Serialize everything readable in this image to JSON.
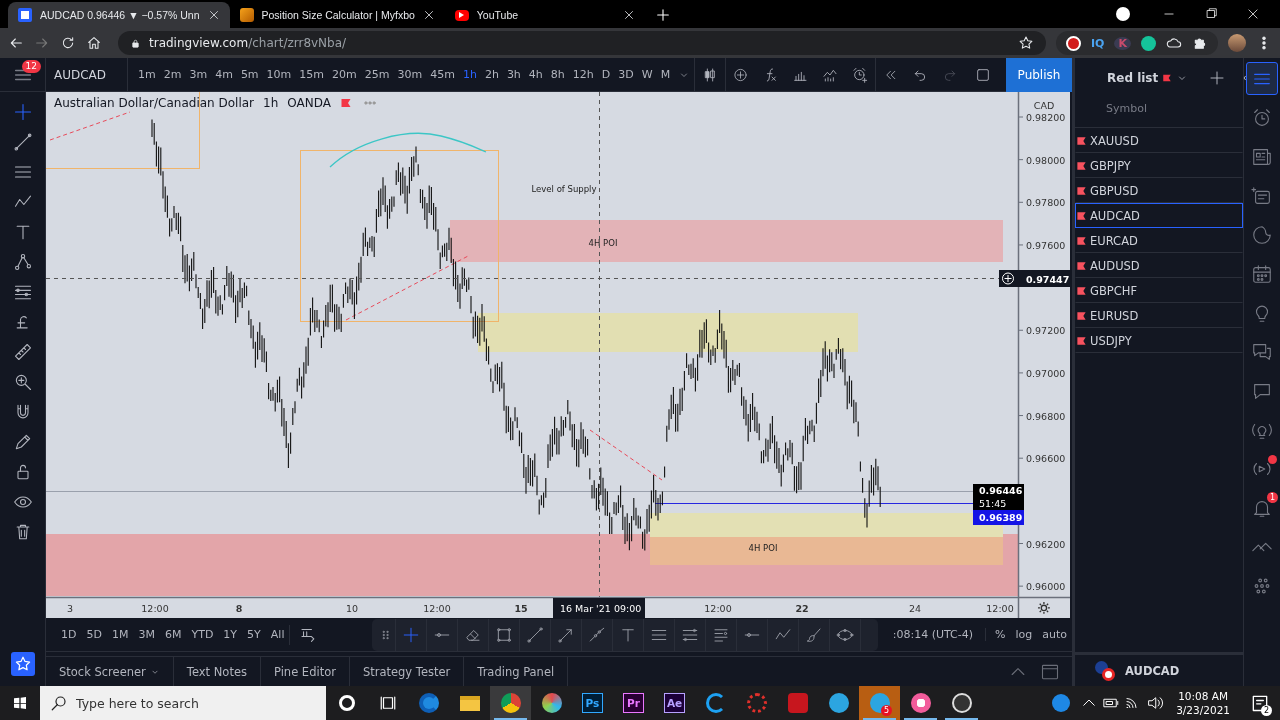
{
  "browser": {
    "tabs": [
      {
        "title": "AUDCAD 0.96446 ▼ −0.57% Unn",
        "kind": "tradingview",
        "selected": true
      },
      {
        "title": "Position Size Calculator | Myfxbo",
        "kind": "fx",
        "selected": false
      },
      {
        "title": "YouTube",
        "kind": "youtube",
        "selected": false
      }
    ],
    "url_host": "tradingview.com",
    "url_path": "/chart/zrr8vNba/",
    "extensions": [
      "IQ",
      "K"
    ]
  },
  "toolbar": {
    "menu_badge": "12",
    "symbol": "AUDCAD",
    "intervals": [
      {
        "label": "1m",
        "selected": false
      },
      {
        "label": "2m",
        "selected": false
      },
      {
        "label": "3m",
        "selected": false
      },
      {
        "label": "4m",
        "selected": false
      },
      {
        "label": "5m",
        "selected": false
      },
      {
        "label": "10m",
        "selected": false
      },
      {
        "label": "15m",
        "selected": false
      },
      {
        "label": "20m",
        "selected": false
      },
      {
        "label": "25m",
        "selected": false
      },
      {
        "label": "30m",
        "selected": false
      },
      {
        "label": "45m",
        "selected": false
      },
      {
        "label": "1h",
        "selected": true
      },
      {
        "label": "2h",
        "selected": false
      },
      {
        "label": "3h",
        "selected": false
      },
      {
        "label": "4h",
        "selected": false
      },
      {
        "label": "8h",
        "selected": false
      },
      {
        "label": "12h",
        "selected": false
      },
      {
        "label": "D",
        "selected": false
      },
      {
        "label": "3D",
        "selected": false
      },
      {
        "label": "W",
        "selected": false
      },
      {
        "label": "M",
        "selected": false
      }
    ],
    "publish": "Publish"
  },
  "chart": {
    "legend": {
      "name": "Australian Dollar/Canadian Dollar",
      "interval": "1h",
      "exchange": "OANDA"
    },
    "currency": "CAD",
    "price_ticks": [
      "0.98200",
      "0.98000",
      "0.97800",
      "0.97600",
      "0.97200",
      "0.97000",
      "0.96800",
      "0.96600",
      "0.96200",
      "0.96000"
    ],
    "time_ticks": [
      {
        "label": "3",
        "major": false
      },
      {
        "label": "12:00",
        "major": false
      },
      {
        "label": "8",
        "major": true
      },
      {
        "label": "10",
        "major": false
      },
      {
        "label": "12:00",
        "major": false
      },
      {
        "label": "15",
        "major": true
      },
      {
        "label": "12:00",
        "major": false
      },
      {
        "label": "22",
        "major": true
      },
      {
        "label": "24",
        "major": false
      },
      {
        "label": "12:00",
        "major": false
      }
    ],
    "annotations": [
      "Level of Supply",
      "4H POI",
      "4H POI"
    ],
    "crosshair_price": "0.97447",
    "crosshair_date": "16 Mar '21",
    "crosshair_time": "09:00",
    "last_price": "0.96446",
    "countdown": "51:45",
    "line_price": "0.96389"
  },
  "range_bar": {
    "ranges": [
      "1D",
      "5D",
      "1M",
      "3M",
      "6M",
      "YTD",
      "1Y",
      "5Y",
      "All"
    ],
    "clock": ":08:14 (UTC-4)",
    "scale_options": [
      "%",
      "log",
      "auto"
    ]
  },
  "bottom_tabs": [
    "Stock Screener",
    "Text Notes",
    "Pine Editor",
    "Strategy Tester",
    "Trading Panel"
  ],
  "watchlist": {
    "title": "Red list",
    "column": "Symbol",
    "items": [
      {
        "symbol": "XAUUSD",
        "selected": false
      },
      {
        "symbol": "GBPJPY",
        "selected": false
      },
      {
        "symbol": "GBPUSD",
        "selected": false
      },
      {
        "symbol": "AUDCAD",
        "selected": true
      },
      {
        "symbol": "EURCAD",
        "selected": false
      },
      {
        "symbol": "AUDUSD",
        "selected": false
      },
      {
        "symbol": "GBPCHF",
        "selected": false
      },
      {
        "symbol": "EURUSD",
        "selected": false
      },
      {
        "symbol": "USDJPY",
        "selected": false
      }
    ],
    "footer_symbol": "AUDCAD"
  },
  "right_bar": {
    "items": [
      {
        "kind": "watchlist",
        "selected": true
      },
      {
        "kind": "alarm",
        "selected": false
      },
      {
        "kind": "news",
        "selected": false
      },
      {
        "kind": "list",
        "selected": false
      },
      {
        "kind": "hotlist",
        "selected": false
      },
      {
        "kind": "calendar",
        "selected": false
      },
      {
        "kind": "ideas",
        "selected": false
      },
      {
        "kind": "chat",
        "selected": false
      },
      {
        "kind": "messages",
        "selected": false
      },
      {
        "kind": "signal",
        "selected": false
      },
      {
        "kind": "stream",
        "selected": false,
        "dot": true
      },
      {
        "kind": "bell",
        "selected": false,
        "badge": "1"
      },
      {
        "kind": "chevrons",
        "selected": false
      },
      {
        "kind": "dots",
        "selected": false
      }
    ]
  },
  "taskbar": {
    "search_placeholder": "Type here to search",
    "apps": [
      {
        "kind": "cortana",
        "running": false
      },
      {
        "kind": "taskview",
        "running": false
      },
      {
        "kind": "edge",
        "running": false
      },
      {
        "kind": "explorer",
        "running": false
      },
      {
        "kind": "chrome",
        "running": true
      },
      {
        "kind": "resolve",
        "running": false
      },
      {
        "kind": "ps",
        "label": "Ps",
        "running": false
      },
      {
        "kind": "pr",
        "label": "Pr",
        "running": false
      },
      {
        "kind": "ae",
        "label": "Ae",
        "running": false
      },
      {
        "kind": "ccleaner",
        "running": false
      },
      {
        "kind": "gear",
        "running": false
      },
      {
        "kind": "rapp",
        "running": false
      },
      {
        "kind": "telegram",
        "running": false
      },
      {
        "kind": "telegram",
        "badge": "5",
        "running": true
      },
      {
        "kind": "music",
        "running": true
      },
      {
        "kind": "obs",
        "running": true
      }
    ],
    "time": "10:08 AM",
    "date": "3/23/2021",
    "notifications": "2"
  }
}
